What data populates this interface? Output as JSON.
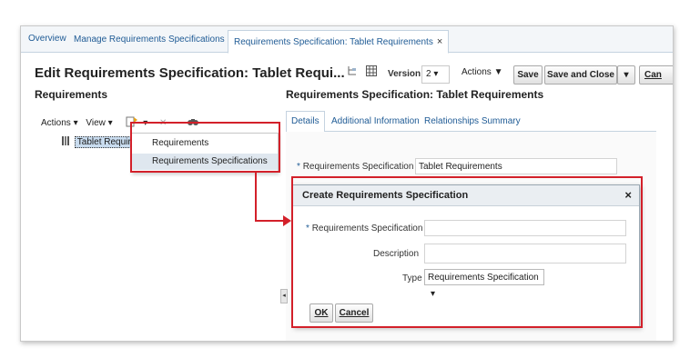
{
  "tabs": [
    {
      "label": "Overview",
      "closable": false
    },
    {
      "label": "Manage Requirements Specifications",
      "closable": true
    },
    {
      "label": "Requirements Specification: Tablet Requirements",
      "closable": true
    }
  ],
  "close_glyph": "×",
  "header": {
    "title": "Edit Requirements Specification: Tablet Requi...",
    "version_label": "Version",
    "version_value": "2 ▾",
    "actions_label": "Actions ▼",
    "save_label": "Save",
    "save_close_label": "Save and Close",
    "split_arrow": "▾",
    "cancel_label": "Can"
  },
  "left_panel": {
    "heading": "Requirements",
    "actions_label": "Actions ▾",
    "view_label": "View ▾",
    "tree_item": "Tablet Require"
  },
  "add_menu": {
    "items": [
      "Requirements",
      "Requirements Specifications"
    ]
  },
  "right_panel": {
    "heading": "Requirements Specification: Tablet Requirements",
    "subtabs": [
      "Details",
      "Additional Information",
      "Relationships Summary"
    ],
    "spec_label": "Requirements Specification",
    "spec_value": "Tablet Requirements"
  },
  "dialog": {
    "title": "Create Requirements Specification",
    "close": "×",
    "required_mark": "*",
    "fields": {
      "spec_label": "Requirements Specification",
      "desc_label": "Description",
      "type_label": "Type",
      "type_value": "Requirements Specification"
    },
    "ok_label": "OK",
    "cancel_label": "Cancel"
  },
  "colors": {
    "highlight_red": "#d3202a",
    "link_blue": "#1f5b95"
  }
}
